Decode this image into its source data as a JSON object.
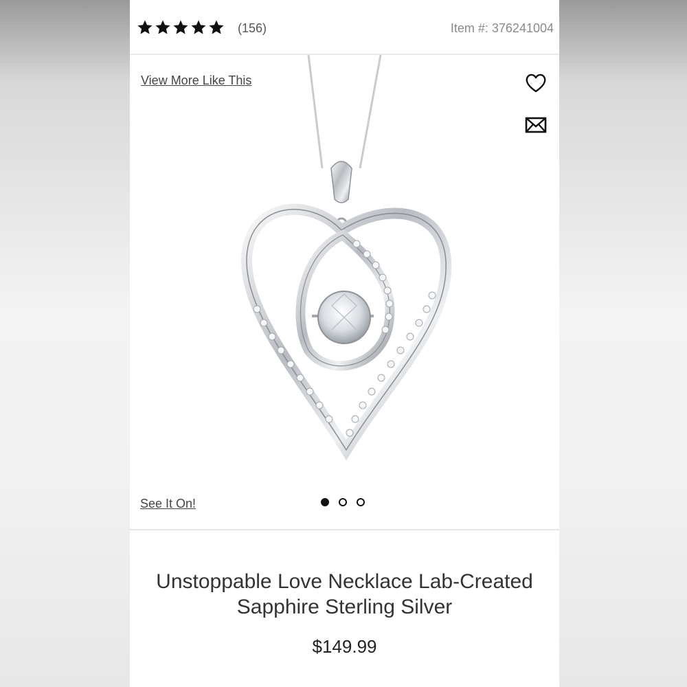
{
  "header": {
    "rating": {
      "stars": 5,
      "max_stars": 5,
      "count_text": "(156)"
    },
    "item_number": "Item #: 376241004"
  },
  "media": {
    "view_more_label": "View More Like This",
    "see_it_on_label": "See It On!",
    "actions": {
      "favorite_icon": "heart-outline-icon",
      "share_icon": "envelope-icon"
    },
    "carousel": {
      "total": 3,
      "active_index": 0
    },
    "image_subject": "heart pendant necklace"
  },
  "product": {
    "title": "Unstoppable Love Necklace Lab-Created Sapphire Sterling Silver",
    "price": "$149.99"
  },
  "colors": {
    "text_dark": "#222222",
    "link": "#444444",
    "muted": "#8a8a8a",
    "divider": "#e6e6e6"
  }
}
